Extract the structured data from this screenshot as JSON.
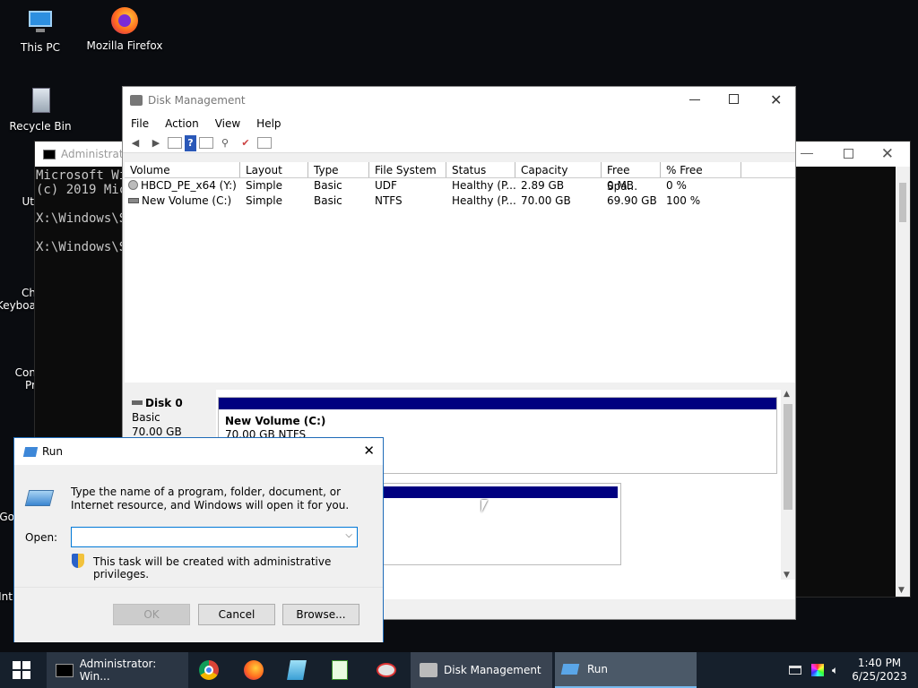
{
  "desktop": {
    "icons": [
      {
        "label": "This PC"
      },
      {
        "label": "Mozilla Firefox"
      },
      {
        "label": "Recycle Bin"
      },
      {
        "label": "Ut"
      },
      {
        "label": "Ch\nKeyboa"
      },
      {
        "label": "Con\nPr"
      },
      {
        "label": "Go"
      },
      {
        "label": "Int"
      }
    ]
  },
  "cmd": {
    "title": "Administrato",
    "lines": [
      "Microsoft Wi",
      "(c) 2019 Mic",
      "",
      "X:\\Windows\\S",
      "",
      "X:\\Windows\\S"
    ]
  },
  "disk_mgmt": {
    "title": "Disk Management",
    "menu": [
      "File",
      "Action",
      "View",
      "Help"
    ],
    "columns": [
      "Volume",
      "Layout",
      "Type",
      "File System",
      "Status",
      "Capacity",
      "Free Spa...",
      "% Free"
    ],
    "rows": [
      [
        "HBCD_PE_x64 (Y:)",
        "Simple",
        "Basic",
        "UDF",
        "Healthy (P...",
        "2.89 GB",
        "0 MB",
        "0 %"
      ],
      [
        "New Volume (C:)",
        "Simple",
        "Basic",
        "NTFS",
        "Healthy (P...",
        "70.00 GB",
        "69.90 GB",
        "100 %"
      ]
    ],
    "disk": {
      "name": "Disk 0",
      "type": "Basic",
      "size": "70.00 GB"
    },
    "partition": {
      "name": "New Volume  (C:)",
      "info": "70.00 GB NTFS"
    }
  },
  "run": {
    "title": "Run",
    "description": "Type the name of a program, folder, document, or Internet resource, and Windows will open it for you.",
    "open_label": "Open:",
    "open_value": "",
    "admin_note": "This task will be created with administrative privileges.",
    "ok": "OK",
    "cancel": "Cancel",
    "browse": "Browse..."
  },
  "taskbar": {
    "items": [
      "Administrator: Win...",
      "Disk Management",
      "Run"
    ],
    "time": "1:40 PM",
    "date": "6/25/2023"
  },
  "colors": {
    "accent": "#000080",
    "taskbar": "#16202c",
    "run_border": "#1e6bb8"
  }
}
